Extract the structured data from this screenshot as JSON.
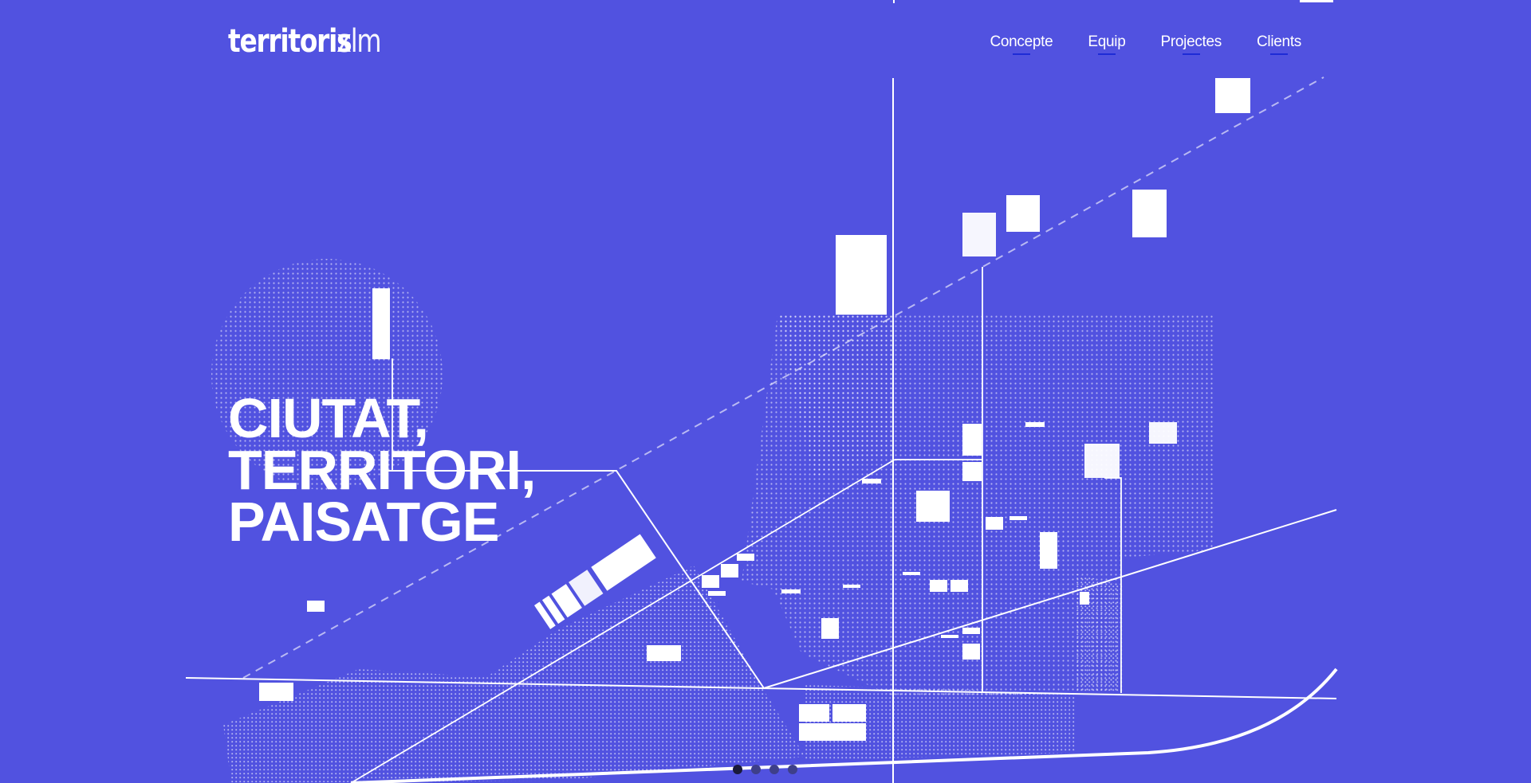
{
  "brand": {
    "logo_bold": "territoris",
    "logo_light": "xlm"
  },
  "nav": {
    "items": [
      {
        "label": "Concepte"
      },
      {
        "label": "Equip"
      },
      {
        "label": "Projectes"
      },
      {
        "label": "Clients"
      }
    ]
  },
  "hero": {
    "lines": [
      "CIUTAT,",
      "TERRITORI,",
      "PAISATGE"
    ]
  },
  "carousel": {
    "slides": 4,
    "active": 1
  },
  "colors": {
    "background": "#5152e0",
    "foreground": "#ffffff",
    "accent": "#1e2bd6"
  }
}
